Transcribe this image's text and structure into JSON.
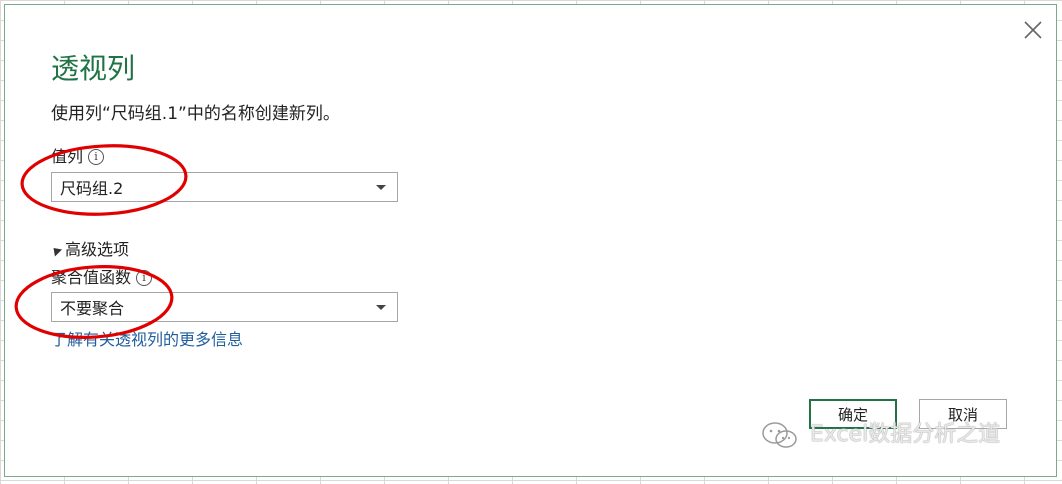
{
  "dialog": {
    "title": "透视列",
    "description": "使用列“尺码组.1”中的名称创建新列。",
    "value_column": {
      "label": "值列",
      "info": "i",
      "selected": "尺码组.2"
    },
    "advanced": {
      "label": "高级选项",
      "aggregate": {
        "label": "聚合值函数",
        "info": "i",
        "selected": "不要聚合"
      }
    },
    "learn_more_link": "了解有关透视列的更多信息",
    "ok_label": "确定",
    "cancel_label": "取消"
  },
  "watermark": {
    "text": "Excel数据分析之道"
  },
  "colors": {
    "accent": "#217346",
    "annotation": "#e00000",
    "link": "#1f5e9e"
  }
}
